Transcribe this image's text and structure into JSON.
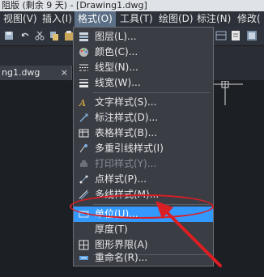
{
  "window": {
    "title": "阻版 (剩余 9 天) - [Drawing1.dwg]"
  },
  "menubar": {
    "items": [
      {
        "label": "视图(V)"
      },
      {
        "label": "插入(I)"
      },
      {
        "label": "格式(O)",
        "active": true
      },
      {
        "label": "工具(T)"
      },
      {
        "label": "绘图(D)"
      },
      {
        "label": "标注(N)"
      },
      {
        "label": "修改("
      }
    ]
  },
  "file_tab": {
    "label": "ng1.dwg",
    "close": "×"
  },
  "format_menu": {
    "items": [
      {
        "label": "图层(L)...",
        "icon": "layers-icon",
        "enabled": true
      },
      {
        "label": "颜色(C)...",
        "icon": "color-palette-icon",
        "enabled": true
      },
      {
        "label": "线型(N)...",
        "icon": "linetype-icon",
        "enabled": true
      },
      {
        "label": "线宽(W)...",
        "icon": "lineweight-icon",
        "enabled": true
      },
      {
        "label": "文字样式(S)...",
        "icon": "text-style-icon",
        "enabled": true
      },
      {
        "label": "标注样式(D)...",
        "icon": "dimension-style-icon",
        "enabled": true
      },
      {
        "label": "表格样式(B)...",
        "icon": "table-style-icon",
        "enabled": true
      },
      {
        "label": "多重引线样式(I)",
        "icon": "multileader-style-icon",
        "enabled": true
      },
      {
        "label": "打印样式(Y)...",
        "icon": "plot-style-icon",
        "enabled": false
      },
      {
        "label": "点样式(P)...",
        "icon": "point-style-icon",
        "enabled": true
      },
      {
        "label": "多线样式(M)...",
        "icon": "multiline-style-icon",
        "enabled": true
      },
      {
        "label": "单位(U)...",
        "icon": "units-icon",
        "enabled": true,
        "highlighted": true
      },
      {
        "label": "厚度(T)",
        "icon": "",
        "enabled": true
      },
      {
        "label": "图形界限(A)",
        "icon": "drawing-limits-icon",
        "enabled": true
      },
      {
        "label": "重命名(R)...",
        "icon": "rename-icon",
        "enabled": true
      }
    ]
  },
  "colors": {
    "highlight": "#3399ff",
    "annotation": "#d91e24",
    "menu_bg": "#3a3d44"
  }
}
